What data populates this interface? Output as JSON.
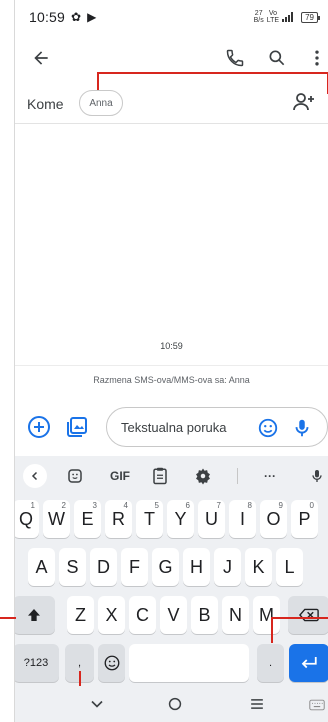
{
  "status_bar": {
    "time": "10:59",
    "net_speed_value": "27",
    "net_speed_unit": "B/s",
    "net_type": "LTE",
    "volte": "Vo",
    "battery": "79"
  },
  "app_bar": {
    "back": "back",
    "actions": [
      "phone",
      "search",
      "more"
    ]
  },
  "to_row": {
    "label": "Kome",
    "recipient_chip": "Anna"
  },
  "conversation": {
    "timestamp": "10:59",
    "info": "Razmena SMS-ova/MMS-ova sa: Anna"
  },
  "compose": {
    "placeholder": "Tekstualna poruka"
  },
  "keyboard": {
    "toolbar": {
      "gif": "GIF",
      "more": "···"
    },
    "row1": [
      {
        "label": "Q",
        "hint": "1"
      },
      {
        "label": "W",
        "hint": "2"
      },
      {
        "label": "E",
        "hint": "3"
      },
      {
        "label": "R",
        "hint": "4"
      },
      {
        "label": "T",
        "hint": "5"
      },
      {
        "label": "Y",
        "hint": "6"
      },
      {
        "label": "U",
        "hint": "7"
      },
      {
        "label": "I",
        "hint": "8"
      },
      {
        "label": "O",
        "hint": "9"
      },
      {
        "label": "P",
        "hint": "0"
      }
    ],
    "row2": [
      "A",
      "S",
      "D",
      "F",
      "G",
      "H",
      "J",
      "K",
      "L"
    ],
    "row3": [
      "Z",
      "X",
      "C",
      "V",
      "B",
      "N",
      "M"
    ],
    "row4": {
      "symbols": "?123",
      "comma": ",",
      "period": "."
    }
  },
  "colors": {
    "accent": "#1a73e8",
    "annotation": "#d7261e",
    "keyboard_bg": "#eef0f3"
  }
}
